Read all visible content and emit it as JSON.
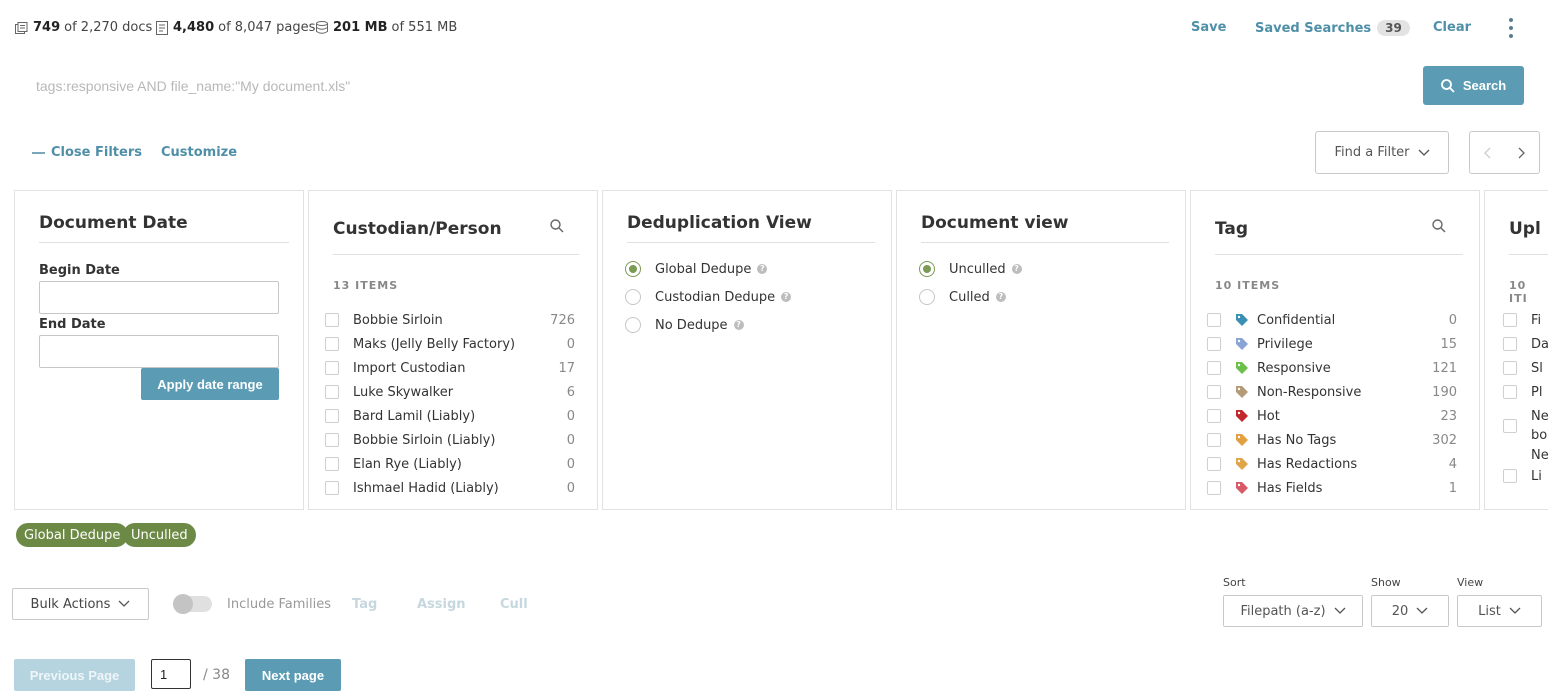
{
  "stats": {
    "docs": {
      "value": "749",
      "text": "of 2,270 docs"
    },
    "pages": {
      "value": "4,480",
      "text": "of 8,047 pages"
    },
    "size": {
      "value": "201 MB",
      "text": "of 551 MB"
    }
  },
  "toolbar": {
    "save_label": "Save",
    "saved_searches_label": "Saved Searches",
    "saved_searches_count": "39",
    "clear_label": "Clear"
  },
  "search": {
    "placeholder": "tags:responsive AND file_name:\"My document.xls\"",
    "value": "",
    "button_label": "Search"
  },
  "filters_bar": {
    "close_label": "Close Filters",
    "customize_label": "Customize",
    "find_filter_label": "Find a Filter"
  },
  "document_date": {
    "title": "Document Date",
    "begin_label": "Begin Date",
    "end_label": "End Date",
    "apply_label": "Apply date range"
  },
  "custodian": {
    "title": "Custodian/Person",
    "count_label": "13 ITEMS",
    "items": [
      {
        "label": "Bobbie Sirloin",
        "count": "726"
      },
      {
        "label": "Maks (Jelly Belly Factory)",
        "count": "0"
      },
      {
        "label": "Import Custodian",
        "count": "17"
      },
      {
        "label": "Luke Skywalker",
        "count": "6"
      },
      {
        "label": "Bard Lamil (Liably)",
        "count": "0"
      },
      {
        "label": "Bobbie Sirloin (Liably)",
        "count": "0"
      },
      {
        "label": "Elan Rye (Liably)",
        "count": "0"
      },
      {
        "label": "Ishmael Hadid (Liably)",
        "count": "0"
      }
    ]
  },
  "dedup": {
    "title": "Deduplication View",
    "options": [
      {
        "label": "Global Dedupe",
        "selected": true
      },
      {
        "label": "Custodian Dedupe",
        "selected": false
      },
      {
        "label": "No Dedupe",
        "selected": false
      }
    ]
  },
  "docview": {
    "title": "Document view",
    "options": [
      {
        "label": "Unculled",
        "selected": true
      },
      {
        "label": "Culled",
        "selected": false
      }
    ]
  },
  "tag": {
    "title": "Tag",
    "count_label": "10 ITEMS",
    "items": [
      {
        "label": "Confidential",
        "count": "0",
        "color": "#3a8fb5"
      },
      {
        "label": "Privilege",
        "count": "15",
        "color": "#8aa4d8"
      },
      {
        "label": "Responsive",
        "count": "121",
        "color": "#6cc04a"
      },
      {
        "label": "Non-Responsive",
        "count": "190",
        "color": "#b59a78"
      },
      {
        "label": "Hot",
        "count": "23",
        "color": "#c0282e"
      },
      {
        "label": "Has No Tags",
        "count": "302",
        "color": "#e2a040"
      },
      {
        "label": "Has Redactions",
        "count": "4",
        "color": "#e0a54a"
      },
      {
        "label": "Has Fields",
        "count": "1",
        "color": "#d85a6a"
      }
    ]
  },
  "upload": {
    "title": "Upl",
    "count_label": "10 ITI",
    "items": [
      "Fi",
      "Da",
      "Sl",
      "Pl",
      "Ne",
      "Li"
    ],
    "wrap_lines": [
      "bo",
      "Ne"
    ]
  },
  "chips": [
    "Global Dedupe",
    "Unculled"
  ],
  "bottom": {
    "bulk_label": "Bulk Actions",
    "include_families_label": "Include Families",
    "tag_label": "Tag",
    "assign_label": "Assign",
    "cull_label": "Cull",
    "sort_label": "Sort",
    "sort_value": "Filepath (a-z)",
    "show_label": "Show",
    "show_value": "20",
    "view_label": "View",
    "view_value": "List"
  },
  "pagination": {
    "prev_label": "Previous Page",
    "current": "1",
    "total": "/ 38",
    "next_label": "Next page"
  },
  "colors": {
    "accent": "#5b9cb4",
    "link": "#4f8fa8",
    "chip": "#6c8a45",
    "radio_selected": "#7a9a55"
  }
}
